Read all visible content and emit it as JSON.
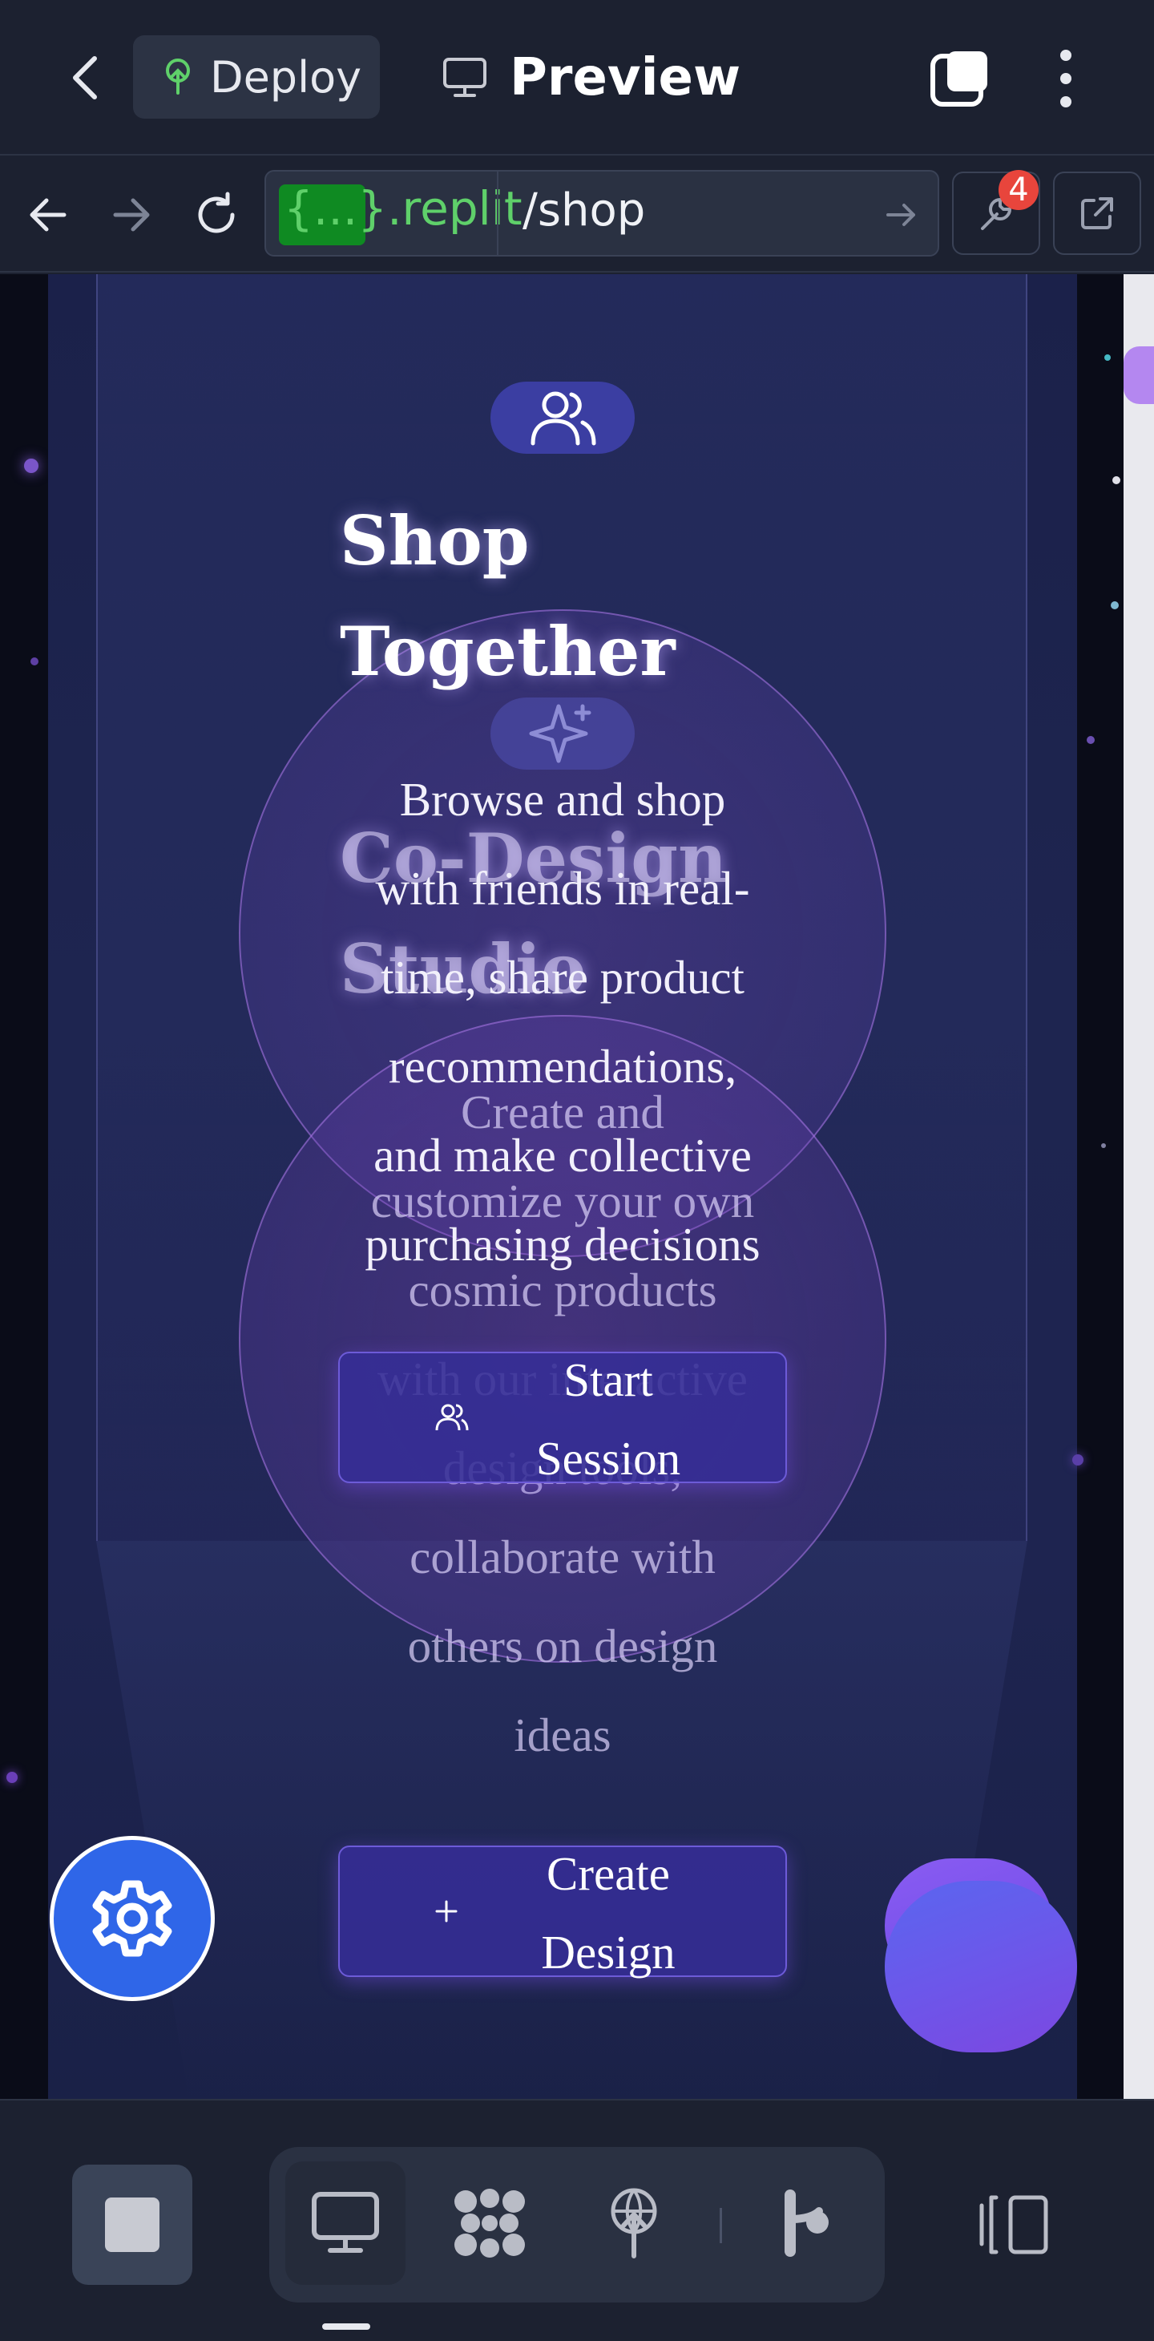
{
  "header": {
    "deploy_label": "Deploy",
    "preview_label": "Preview"
  },
  "urlbar": {
    "host_badge": "{...}",
    "host": ".replit",
    "path": "/shop",
    "tools_badge_count": "4"
  },
  "page": {
    "card1": {
      "icon": "users-icon",
      "title_line1": "Shop",
      "title_line2": "Together",
      "desc_lines": [
        "Browse and shop",
        "with friends in real-",
        "time, share product",
        "recommendations,",
        "and make collective",
        "purchasing decisions"
      ],
      "cta_line1": "Start",
      "cta_line2": "Session"
    },
    "card2": {
      "icon": "sparkle-icon",
      "title_line1": "Co-Design",
      "title_line2": "Studio",
      "desc_lines": [
        "Create and",
        "customize your own",
        "cosmic products",
        "with our interactive",
        "design tools,",
        "collaborate with",
        "others on design",
        "ideas"
      ],
      "cta_line1": "Create",
      "cta_line2": "Design"
    }
  },
  "colors": {
    "accent": "#3b3ea2",
    "fab_settings": "#2f66e8",
    "fab_chat": "#6c57ea",
    "badge": "#e8453c"
  },
  "bottombar": {
    "icons": [
      "stop-icon",
      "monitor-icon",
      "workspace-icon",
      "deploy-icon",
      "git-icon",
      "panel-icon"
    ]
  }
}
